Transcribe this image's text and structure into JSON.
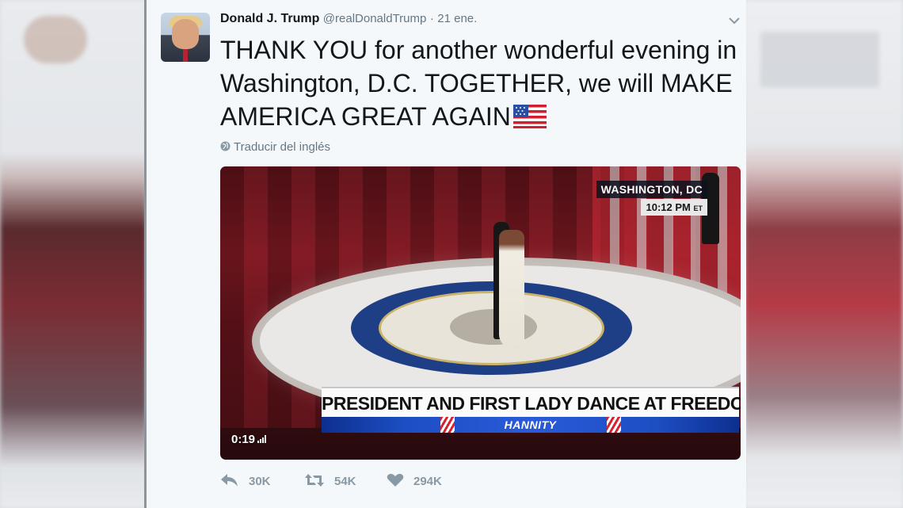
{
  "tweet": {
    "author_name": "Donald J. Trump",
    "handle": "@realDonaldTrump",
    "separator": "·",
    "date": "21 ene.",
    "text": "THANK YOU for another wonderful evening in Washington, D.C. TOGETHER, we will MAKE AMERICA GREAT AGAIN",
    "text_emoji_icon": "us-flag-icon",
    "translate_label": "Traducir del inglés"
  },
  "video": {
    "location": "WASHINGTON, DC",
    "time": "10:12 PM",
    "time_zone": "ET",
    "headline": "PRESIDENT AND FIRST LADY DANCE AT FREEDOM BALL",
    "show_name": "HANNITY",
    "elapsed": "0:19"
  },
  "actions": {
    "reply_icon": "reply-icon",
    "reply_count": "30K",
    "retweet_icon": "retweet-icon",
    "retweet_count": "54K",
    "like_icon": "heart-icon",
    "like_count": "294K"
  },
  "colors": {
    "card_background": "#f5f8fa",
    "primary_text": "#14171a",
    "secondary_text": "#657786",
    "action_icon": "#8899a6",
    "show_bar_blue": "#1d4ec3"
  }
}
